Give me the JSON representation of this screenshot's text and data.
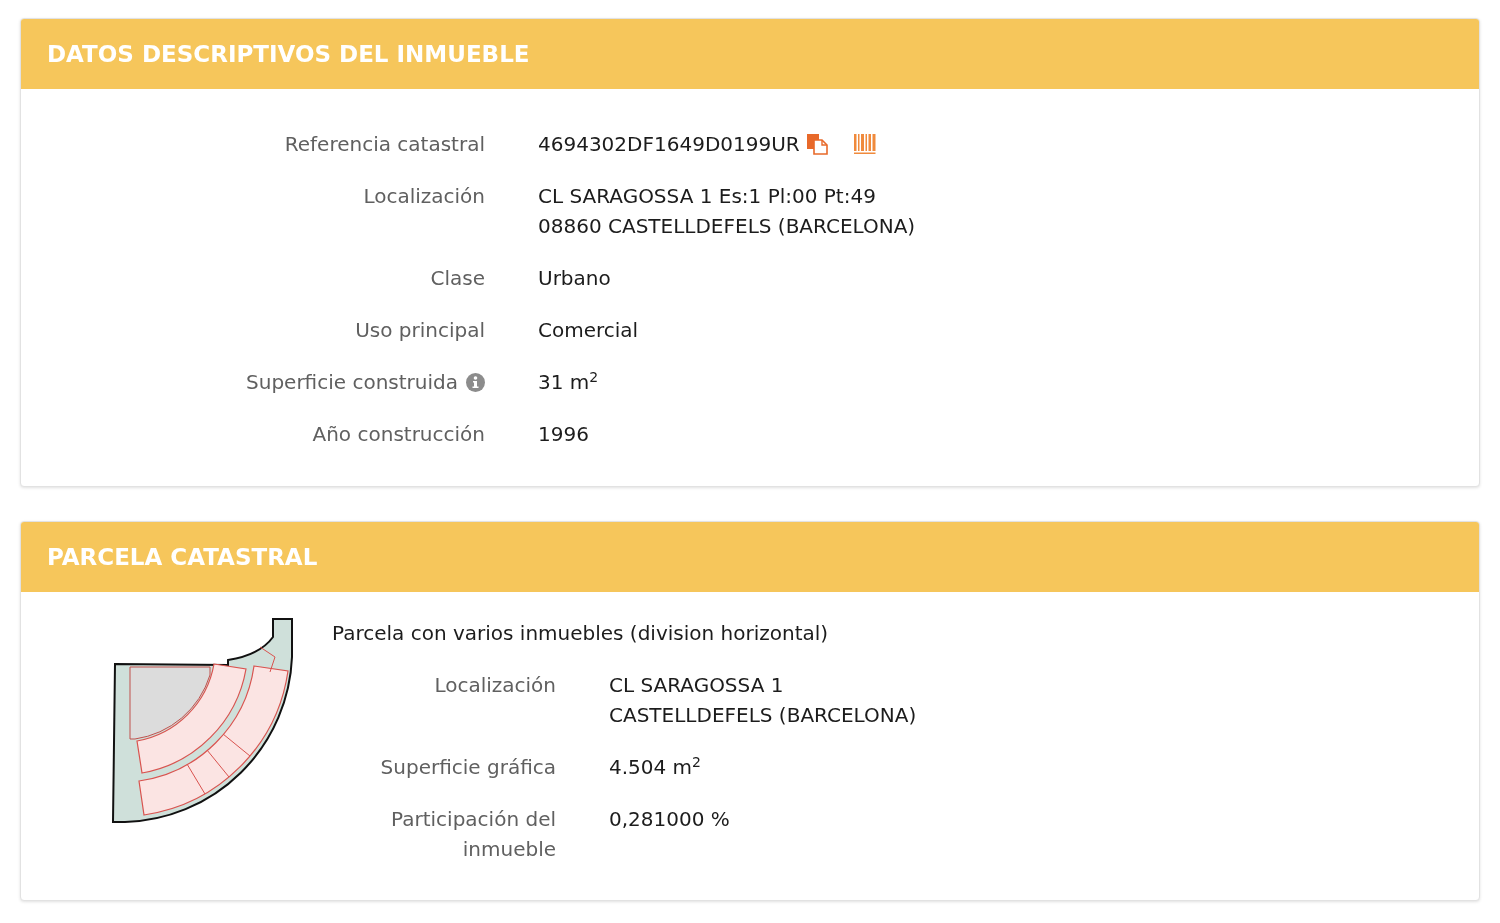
{
  "property": {
    "title": "DATOS DESCRIPTIVOS DEL INMUEBLE",
    "rows": [
      {
        "kind": "reference",
        "label": "Referencia catastral",
        "lines": [
          "4694302DF1649D0199UR"
        ]
      },
      {
        "kind": "plain",
        "label": "Localización",
        "lines": [
          "CL SARAGOSSA 1 Es:1 Pl:00 Pt:49",
          "08860 CASTELLDEFELS (BARCELONA)"
        ]
      },
      {
        "kind": "plain",
        "label": "Clase",
        "lines": [
          "Urbano"
        ]
      },
      {
        "kind": "plain",
        "label": "Uso principal",
        "lines": [
          "Comercial"
        ]
      },
      {
        "kind": "info",
        "label": "Superficie construida",
        "lines": [
          "31 m$^{2}$"
        ]
      },
      {
        "kind": "plain",
        "label": "Año construcción",
        "lines": [
          "1996"
        ]
      }
    ]
  },
  "parcel": {
    "title": "PARCELA CATASTRAL",
    "note": "Parcela con varios inmuebles (division horizontal)",
    "rows": [
      {
        "label": "Localización",
        "lines": [
          "CL SARAGOSSA 1",
          "CASTELLDEFELS (BARCELONA)"
        ]
      },
      {
        "label": "Superficie gráfica",
        "lines": [
          "4.504 m$^{2}$"
        ]
      },
      {
        "label": "Participación del inmueble",
        "lines": [
          "0,281000 %"
        ]
      }
    ]
  }
}
